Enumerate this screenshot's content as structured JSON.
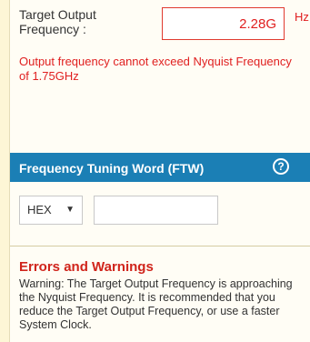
{
  "frequency": {
    "label": "Target Output Frequency :",
    "value": "2.28G",
    "unit": "Hz"
  },
  "error_message": "Output frequency cannot exceed Nyquist Frequency of 1.75GHz",
  "ftw": {
    "title": "Frequency Tuning Word (FTW)",
    "help_label": "?",
    "format_selected": "HEX",
    "value": ""
  },
  "warnings": {
    "title": "Errors and Warnings",
    "text": "Warning: The Target Output Frequency is approaching the Nyquist Frequency. It is recommended that you reduce the Target Output Frequency, or use a faster System Clock."
  },
  "colors": {
    "error": "#e02020",
    "header_bg": "#1b7fb5"
  }
}
